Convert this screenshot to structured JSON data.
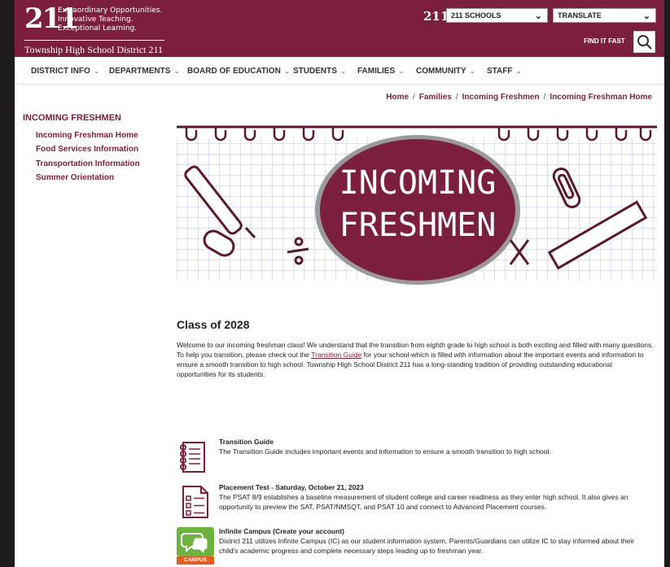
{
  "header": {
    "logo_text": "211",
    "tagline": [
      "Extraordinary Opportunities.",
      "Innovative Teaching.",
      "Exceptional Learning."
    ],
    "district_name": "Township High School District 211",
    "schools_mark": "211",
    "schools_select": "211 SCHOOLS",
    "translate_select": "TRANSLATE",
    "find_it_fast": "FIND IT FAST",
    "brand_color": "#7c1f3e"
  },
  "nav": {
    "items": [
      "DISTRICT INFO",
      "DEPARTMENTS",
      "BOARD OF EDUCATION",
      "STUDENTS",
      "FAMILIES",
      "COMMUNITY",
      "STAFF"
    ]
  },
  "breadcrumb": [
    "Home",
    "Families",
    "Incoming Freshmen",
    "Incoming Freshman Home"
  ],
  "sidebar": {
    "title": "INCOMING FRESHMEN",
    "links": [
      "Incoming Freshman Home",
      "Food Services Information",
      "Transportation Information",
      "Summer Orientation"
    ]
  },
  "banner": {
    "line1": "INCOMING",
    "line2": "FRESHMEN"
  },
  "content": {
    "heading": "Class of 2028",
    "intro_before": "Welcome to our incoming freshman class! We understand that the transition from eighth grade to high school is both exciting and filled with many questions. To help you transition, please check out the ",
    "intro_link": "Transition Guide",
    "intro_after": " for your school-which is filled with information about the important events and information to ensure a smooth transition to high school.  Township High School District 211 has a long-standing tradition of providing outstanding educational opportunities for its students."
  },
  "resources": [
    {
      "title": "Transition Guide",
      "desc": "The Transition Guide includes important events and information to ensure a smooth transition to high school.",
      "icon": "notebook-icon"
    },
    {
      "title": "Placement Test - Saturday, October 21, 2023",
      "desc": "The PSAT 8/9 establishes a baseline measurement of student college and career readiness as they enter high school. It also gives an opportunity to preview the SAT, PSAT/NMSQT, and PSAT 10 and connect to Advanced Placement courses.",
      "icon": "checklist-icon"
    },
    {
      "title": "Infinite Campus (Create your account)",
      "desc": "District 211 utilizes Infinite Campus (IC) as our student information system. Parents/Guardians can utilize IC to stay informed about their child's academic progress and complete necessary steps leading up to freshman year.",
      "icon": "campus-icon",
      "badge": "CAMPUS"
    }
  ]
}
